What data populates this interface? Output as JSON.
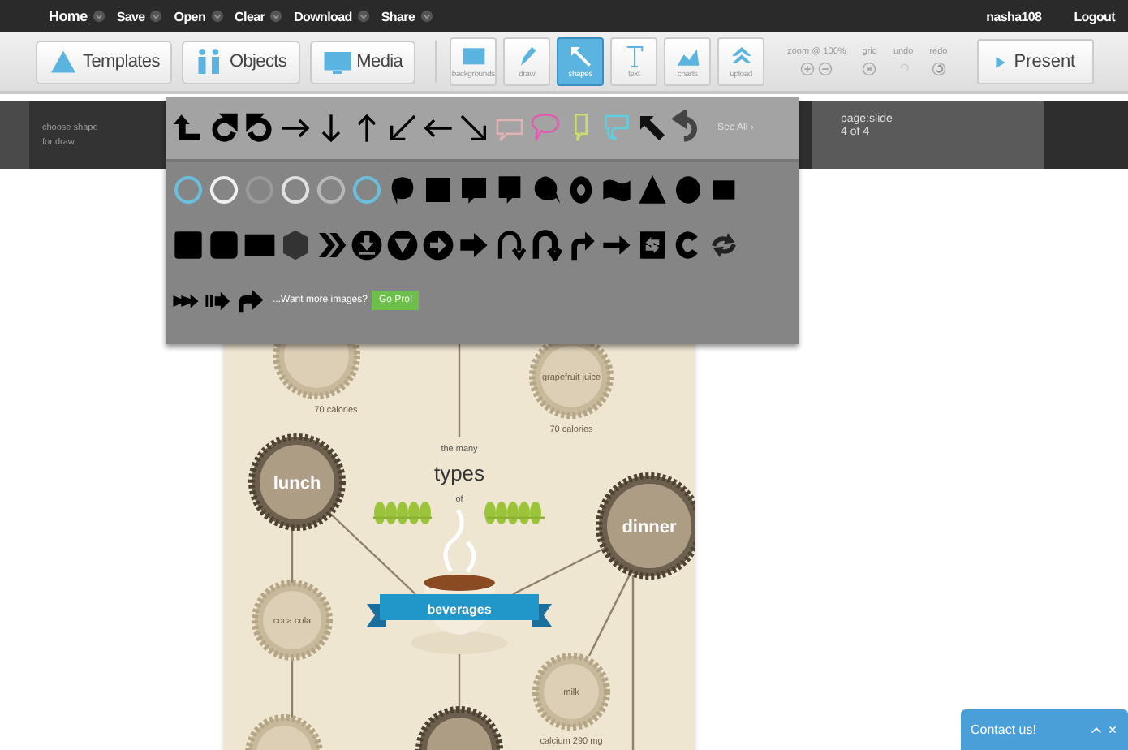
{
  "nav": {
    "links": [
      "Home",
      "Save",
      "Open",
      "Clear",
      "Download",
      "Share"
    ],
    "user": "nasha108",
    "logout": "Logout"
  },
  "toolbar": {
    "main_buttons": [
      "Templates",
      "Objects",
      "Media"
    ],
    "tools": [
      {
        "label": "backgrounds",
        "selected": false
      },
      {
        "label": "draw",
        "selected": false
      },
      {
        "label": "shapes",
        "selected": true
      },
      {
        "label": "text",
        "selected": false
      },
      {
        "label": "charts",
        "selected": false
      },
      {
        "label": "upload",
        "selected": false
      }
    ],
    "zoom": "zoom @ 100%",
    "grid": "grid",
    "undo": "undo",
    "redo": "redo",
    "present": "Present"
  },
  "shape_panel": {
    "hint_lines": [
      "choose shape",
      "for draw"
    ],
    "see_all": "See All ›",
    "promo": "...Want more images?",
    "pro_button": "Go Pro!"
  },
  "page_info": {
    "label": "page:slide",
    "count": "4 of 4"
  },
  "slide": {
    "title_lines": [
      "the many",
      "types",
      "of"
    ],
    "banner": "beverages",
    "nodes": [
      {
        "kind": "light",
        "caption": "70 calories"
      },
      {
        "kind": "light",
        "label": "grapefruit juice",
        "caption": "70 calories"
      },
      {
        "kind": "dark",
        "label": "lunch"
      },
      {
        "kind": "dark",
        "label": "dinner"
      },
      {
        "kind": "light",
        "label": "coca cola"
      },
      {
        "kind": "light",
        "label": "milk",
        "caption": "calcium 290 mg"
      },
      {
        "kind": "light"
      },
      {
        "kind": "dark"
      }
    ]
  },
  "contact": {
    "label": "Contact us!"
  }
}
